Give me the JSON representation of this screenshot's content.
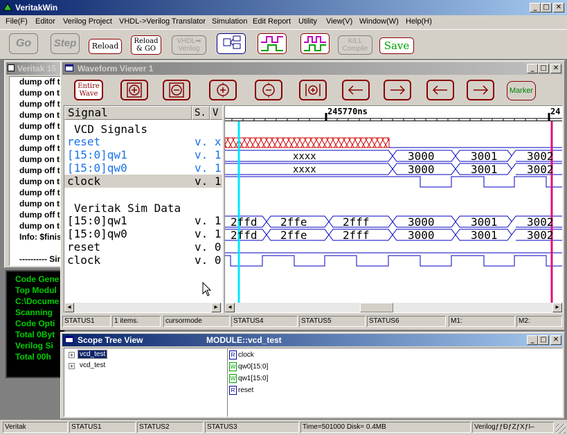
{
  "app": {
    "title": "VeritakWin"
  },
  "menu": [
    "File(F)",
    "Editor",
    "Verilog Project",
    "VHDL->Verilog Translator",
    "Simulation",
    "Edit Report",
    "Utility",
    "View(V)",
    "Window(W)",
    "Help(H)"
  ],
  "toolbar": {
    "go": "Go",
    "step": "Step",
    "reload": "Reload",
    "reload_go_1": "Reload",
    "reload_go_2": "& GO",
    "vhdl_1": "VHDL➡",
    "vhdl_2": "Verilog",
    "kill_1": "KILL",
    "kill_2": "Compile",
    "save": "Save"
  },
  "console": {
    "title": "Veritak 15",
    "lines": [
      "dump off ti",
      "dump on ti",
      "dump off ti",
      "dump on ti",
      "dump off ti",
      "dump on ti",
      "dump off ti",
      "dump on ti",
      "dump off ti",
      "dump on ti",
      "dump off ti",
      "dump on ti",
      "dump off ti",
      "dump on ti",
      "Info: $finis",
      "",
      "---------- Sim"
    ]
  },
  "compile_log": [
    "Code Gene",
    "Top Modul",
    "C:\\Docume",
    "Scanning",
    "Code Opti",
    "Total 0Byt",
    "Verilog Si",
    "Total  00h"
  ],
  "waveform": {
    "title": "Waveform Viewer 1",
    "buttons": {
      "entire_1": "Entire",
      "entire_2": "Wave",
      "marker": "Marker"
    },
    "col_signal": "Signal",
    "col_s": "S.",
    "col_v": "V",
    "time_label": "245770ns",
    "time_label_right": "24",
    "groups": [
      {
        "title": "VCD Signals",
        "signals": [
          {
            "name": "reset",
            "v": "v. x"
          },
          {
            "name": "[15:0]qw1",
            "v": "v. 1"
          },
          {
            "name": "[15:0]qw0",
            "v": "v. 1"
          },
          {
            "name": "clock",
            "v": "v. 1"
          }
        ]
      },
      {
        "title": "Veritak Sim Data",
        "signals": [
          {
            "name": "[15:0]qw1",
            "v": "v. 1"
          },
          {
            "name": "[15:0]qw0",
            "v": "v. 1"
          },
          {
            "name": "reset",
            "v": "v. 0"
          },
          {
            "name": "clock",
            "v": "v. 0"
          }
        ]
      }
    ],
    "vcd_values": {
      "xxxx": "xxxx",
      "v3000": "3000",
      "v3001": "3001",
      "v3002": "3002"
    },
    "sim_values": {
      "a": "2ffd",
      "b": "2ffe",
      "c": "2fff",
      "d": "3000",
      "e": "3001",
      "f": "3002"
    },
    "status": [
      "STATUS1",
      "1 items.",
      "cursormode",
      "STATUS4",
      "STATUS5",
      "STATUS6",
      "M1:",
      "M2:"
    ]
  },
  "scope": {
    "title": "Scope Tree View",
    "module": "MODULE::vcd_test",
    "tree": [
      "vcd_test",
      "vcd_test"
    ],
    "regs": [
      {
        "badge": "R",
        "name": "clock"
      },
      {
        "badge": "W",
        "name": "qw0[15:0]"
      },
      {
        "badge": "W",
        "name": "qw1[15:0]"
      },
      {
        "badge": "R",
        "name": "reset"
      }
    ]
  },
  "statusbar": [
    "Veritak",
    "STATUS1",
    "STATUS2",
    "STATUS3",
    "Time=501000 Disk=  0.4MB",
    "VerilogƒƒÐƒZƒXƒI–"
  ],
  "colors": {
    "title_active": "#0a246a",
    "signal_blue": "#1a73e8",
    "cursor_cyan": "#00e5ff",
    "cursor_magenta": "#e0107a",
    "wave_blue": "#0000c0",
    "compile_green": "#00d000"
  }
}
